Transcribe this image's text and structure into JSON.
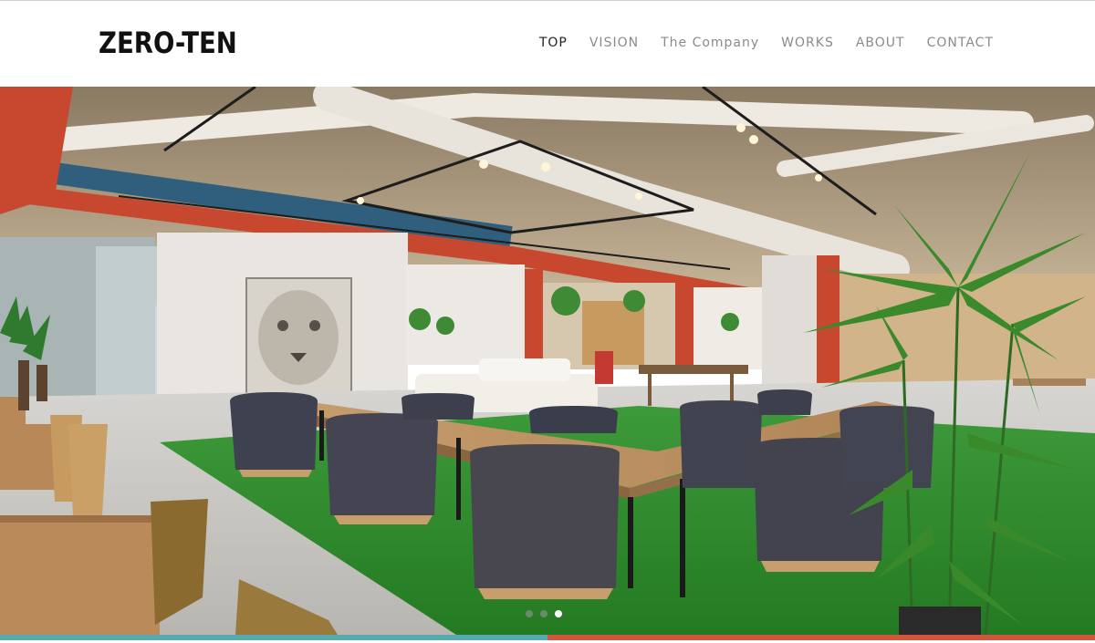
{
  "header": {
    "logo": "ZERO-TEN",
    "nav": [
      {
        "label": "TOP",
        "active": true
      },
      {
        "label": "VISION",
        "active": false
      },
      {
        "label": "The Company",
        "active": false
      },
      {
        "label": "WORKS",
        "active": false
      },
      {
        "label": "ABOUT",
        "active": false
      },
      {
        "label": "CONTACT",
        "active": false
      }
    ]
  },
  "slider": {
    "slide_count": 3,
    "active_slide": 3
  },
  "colors": {
    "bar_left": "#57aab0",
    "bar_right": "#d2553c",
    "accent_red": "#c8472f",
    "carpet_green": "#2f8a2e"
  }
}
